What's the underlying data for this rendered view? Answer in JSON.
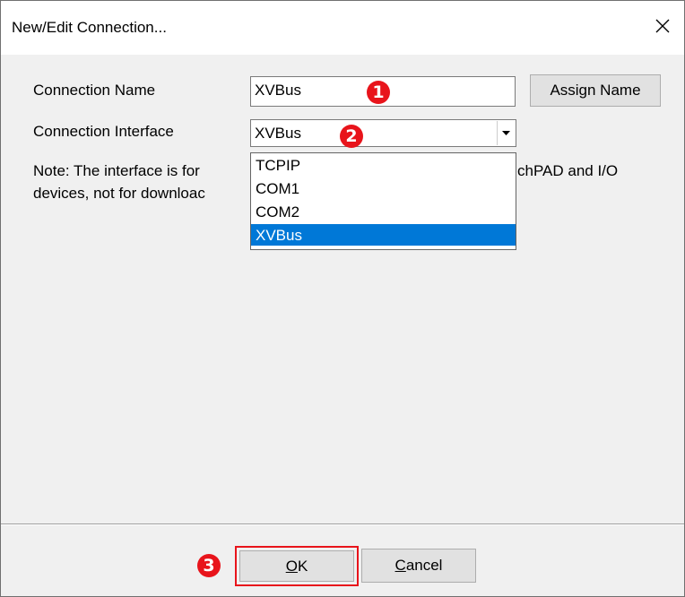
{
  "window": {
    "title": "New/Edit Connection...",
    "close_glyph": "✕"
  },
  "form": {
    "name_label": "Connection Name",
    "name_value": "XVBus",
    "assign_button": "Assign Name",
    "interface_label": "Connection Interface",
    "interface_value": "XVBus",
    "note_line1_start": "Note: The interface is for",
    "note_line1_end": "chPAD and I/O",
    "note_line2_start": "devices, not for downloac"
  },
  "dropdown": {
    "options": [
      "TCPIP",
      "COM1",
      "COM2",
      "XVBus"
    ],
    "selected": "XVBus"
  },
  "badges": {
    "one": "1",
    "two": "2",
    "three": "3"
  },
  "footer": {
    "ok_prefix": "",
    "ok_mnemonic": "O",
    "ok_rest": "K",
    "cancel_mnemonic": "C",
    "cancel_rest": "ancel"
  },
  "colors": {
    "badge": "#e8141b",
    "highlight": "#0078d7",
    "ok_outline": "#e8141b"
  }
}
